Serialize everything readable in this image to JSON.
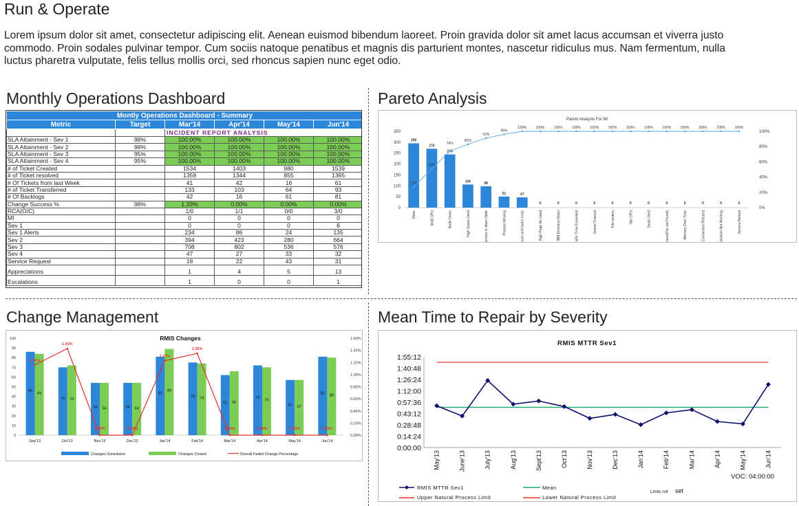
{
  "page": {
    "title": "Run & Operate",
    "intro": "Lorem ipsum dolor sit amet, consectetur adipiscing elit. Aenean euismod bibendum laoreet. Proin gravida dolor sit amet lacus accumsan et viverra justo commodo. Proin sodales pulvinar tempor. Cum sociis natoque penatibus et magnis dis parturient montes, nascetur ridiculus mus. Nam fermentum, nulla luctus pharetra vulputate, felis tellus mollis orci, sed rhoncus sapien nunc eget odio."
  },
  "sections": {
    "dashboard": "Monthly Operations Dashboard",
    "pareto": "Pareto Analysis",
    "change": "Change Management",
    "mttr": "Mean Time to Repair by Severity"
  },
  "colors": {
    "blue": "#2e86d9",
    "green": "#7ccd55",
    "red": "#e8302a",
    "navy": "#0d0d70",
    "mean": "#1aa56b"
  },
  "chart_data": [
    {
      "type": "table",
      "title": "Montly Operations Dashboard - Summary",
      "subheader": "INCIDENT  REPORT  ANALYSIS",
      "columns": [
        "Metric",
        "Target",
        "Mar'14",
        "Apr'14",
        "May'14",
        "Jun'14"
      ],
      "rows": [
        {
          "cells": [
            "SLA Attainment - Sev 1",
            "98%",
            "100.00%",
            "100.00%",
            "100.00%",
            "100.00%"
          ],
          "green": true
        },
        {
          "cells": [
            "SLA Attainment - Sev 2",
            "98%",
            "100.00%",
            "100.00%",
            "100.00%",
            "100.00%"
          ],
          "green": true
        },
        {
          "cells": [
            "SLA Attainment - Sev 3",
            "95%",
            "100.00%",
            "100.00%",
            "100.00%",
            "100.00%"
          ],
          "green": true
        },
        {
          "cells": [
            "SLA Attainment - Sev 4",
            "95%",
            "100.00%",
            "100.00%",
            "100.00%",
            "100.00%"
          ],
          "green": true
        },
        {
          "cells": [
            "# of Ticket Created",
            "",
            "1534",
            "1403",
            "980",
            "1539"
          ]
        },
        {
          "cells": [
            "# of Ticket resolved",
            "",
            "1359",
            "1344",
            "855",
            "1365"
          ]
        },
        {
          "cells": [
            "# Of Tickets  from last Week",
            "",
            "41",
            "42",
            "16",
            "61"
          ]
        },
        {
          "cells": [
            "# of Ticket Transferred",
            "",
            "133",
            "103",
            "64",
            "93"
          ]
        },
        {
          "cells": [
            "# Of Backlogs",
            "",
            "42",
            "16",
            "61",
            "81"
          ]
        },
        {
          "cells": [
            "Change Success %",
            "98%",
            "1.33%",
            "0.00%",
            "0.00%",
            "0.00%"
          ],
          "green": true
        },
        {
          "cells": [
            "RCA(O/C)",
            "",
            "1/0",
            "1/1",
            "0/0",
            "3/0"
          ]
        },
        {
          "cells": [
            "MI",
            "",
            "0",
            "0",
            "0",
            "0"
          ]
        },
        {
          "cells": [
            "Sev 1",
            "",
            "0",
            "0",
            "0",
            "8"
          ]
        },
        {
          "cells": [
            "Sev 1 Alerts",
            "",
            "234",
            "86",
            "24",
            "135"
          ]
        },
        {
          "cells": [
            "Sev 2",
            "",
            "394",
            "423",
            "280",
            "664"
          ]
        },
        {
          "cells": [
            "Sev 3",
            "",
            "708",
            "802",
            "536",
            "576"
          ]
        },
        {
          "cells": [
            "Sev 4",
            "",
            "47",
            "27",
            "33",
            "32"
          ]
        },
        {
          "cells": [
            "Service Request",
            "",
            "18",
            "22",
            "43",
            "31"
          ]
        },
        {
          "cells": [
            "Appreciations",
            "",
            "1",
            "4",
            "5",
            "13"
          ],
          "big": true
        },
        {
          "cells": [
            "Escalations",
            "",
            "1",
            "0",
            "0",
            "1"
          ],
          "big": true
        }
      ]
    },
    {
      "type": "bar",
      "title": "Pareto Analysis For MI",
      "categories": [
        "Other",
        "MnB CPU",
        "Node Down",
        "High Space Used",
        "Service Is down State",
        "Process Missing",
        "Frequent hangs(Performance issues and batch runs)",
        "High Page file Used",
        "IBM Directory Down",
        "Transfer Time Exceeded",
        "Socket Timeout",
        "File system",
        "Idle CPU",
        "Swap Used",
        "Error in process(File not Found)",
        "Memory Over Time",
        "Connection Refused",
        "Application Not Working",
        "Service Reboot"
      ],
      "values": [
        295,
        270,
        244,
        106,
        98,
        51,
        47,
        0,
        0,
        0,
        0,
        0,
        0,
        0,
        0,
        0,
        0,
        0,
        0
      ],
      "cumulative_pct": [
        "27%",
        "51%",
        "74%",
        "83%",
        "91%",
        "96%",
        "100%",
        "100%",
        "100%",
        "100%",
        "100%",
        "100%",
        "100%",
        "100%",
        "100%",
        "100%",
        "100%",
        "100%",
        "100%"
      ],
      "ylim": [
        0,
        350
      ],
      "yticks": [
        0,
        50,
        100,
        150,
        200,
        250,
        300,
        350
      ],
      "y2ticks": [
        "0%",
        "20%",
        "40%",
        "60%",
        "80%",
        "100%"
      ]
    },
    {
      "type": "bar",
      "title": "RMIS Changes",
      "categories": [
        "Sep'13",
        "Oct'13",
        "Nov'13",
        "Dec'13",
        "Jan'14",
        "Feb'14",
        "Mar'14",
        "Apr'14",
        "May'14",
        "Jun'14"
      ],
      "series": [
        {
          "name": "Changes Scheduled",
          "values": [
            86,
            70,
            54,
            54,
            81,
            75,
            62,
            72,
            57,
            81
          ]
        },
        {
          "name": "Changes Closed",
          "values": [
            84,
            72,
            54,
            54,
            89,
            74,
            66,
            70,
            57,
            80
          ]
        },
        {
          "name": "Overall Failed Change Percentage",
          "values": [
            1.16,
            1.43,
            0,
            0,
            1.23,
            1.35,
            0,
            0,
            0,
            0
          ],
          "labels": [
            "1.16%",
            "1.43%",
            "0.00%",
            "0.00%",
            "1.23%",
            "1.35%",
            "0.00%",
            "0.00%",
            "0.00%",
            "0.00%"
          ]
        }
      ],
      "ylim": [
        0,
        100
      ],
      "yticks": [
        0,
        10,
        20,
        30,
        40,
        50,
        60,
        70,
        80,
        90,
        100
      ],
      "y2ticks": [
        "0.00%",
        "0.20%",
        "0.40%",
        "0.60%",
        "0.80%",
        "1.00%",
        "1.20%",
        "1.40%",
        "1.60%"
      ]
    },
    {
      "type": "line",
      "title": "RMIS MTTR Sev1",
      "categories": [
        "May'13",
        "June'13",
        "July'13",
        "Aug'13",
        "Sept'13",
        "Oct'13",
        "Nov'13",
        "Dec'13",
        "Jan'14",
        "Feb'14",
        "Mar'14",
        "Apr'14",
        "May'14",
        "Jun'14"
      ],
      "series": [
        {
          "name": "RMIS MTTR Sev1",
          "values": [
            53,
            40,
            85,
            55,
            59,
            52,
            37,
            42,
            29,
            44,
            48,
            33,
            30,
            80
          ]
        },
        {
          "name": "Mean",
          "values": [
            51,
            51,
            51,
            51,
            51,
            51,
            51,
            51,
            51,
            51,
            51,
            51,
            51,
            51
          ]
        },
        {
          "name": "Upper Natural Process Limit",
          "values": [
            108,
            108,
            108,
            108,
            108,
            108,
            108,
            108,
            108,
            108,
            108,
            108,
            108,
            108
          ]
        },
        {
          "name": "Lower Natural Process Limit",
          "values": []
        }
      ],
      "ylim": [
        0,
        115
      ],
      "yticks": [
        "0:00:00",
        "0:14:24",
        "0:28:48",
        "0:43:12",
        "0:57:36",
        "1:12:00",
        "1:26:24",
        "1:40:48",
        "1:55:12"
      ],
      "note": "VOC: 04:00:00",
      "limits_note": "Limits not",
      "limits_note2": "set"
    }
  ]
}
